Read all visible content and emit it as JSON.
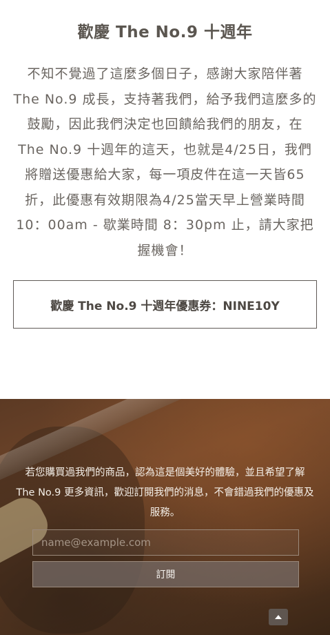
{
  "promo": {
    "title": "歡慶 The No.9 十週年",
    "body": "不知不覺過了這麼多個日子，感謝大家陪伴著 The No.9 成長，支持著我們，給予我們這麼多的鼓勵，因此我們決定也回饋給我們的朋友，在 The No.9 十週年的這天，也就是4/25日，我們將贈送優惠給大家，每一項皮件在這一天皆65折，此優惠有效期限為4/25當天早上營業時間 10：00am - 歇業時間 8：30pm 止，請大家把握機會！",
    "coupon": "歡慶 The No.9 十週年優惠券：NINE10Y"
  },
  "subscribe": {
    "text": "若您購買過我們的商品，認為這是個美好的體驗，並且希望了解 The No.9 更多資訊，歡迎訂閱我們的消息，不會錯過我們的優惠及服務。",
    "email_placeholder": "name@example.com",
    "email_value": "",
    "button_label": "訂閱"
  },
  "icons": {
    "back_to_top": "caret-up-icon"
  },
  "colors": {
    "title_text": "#5b5650",
    "body_text": "#6a6560",
    "subscribe_bg": "#6b4429",
    "button_bg": "#7a6f68"
  }
}
